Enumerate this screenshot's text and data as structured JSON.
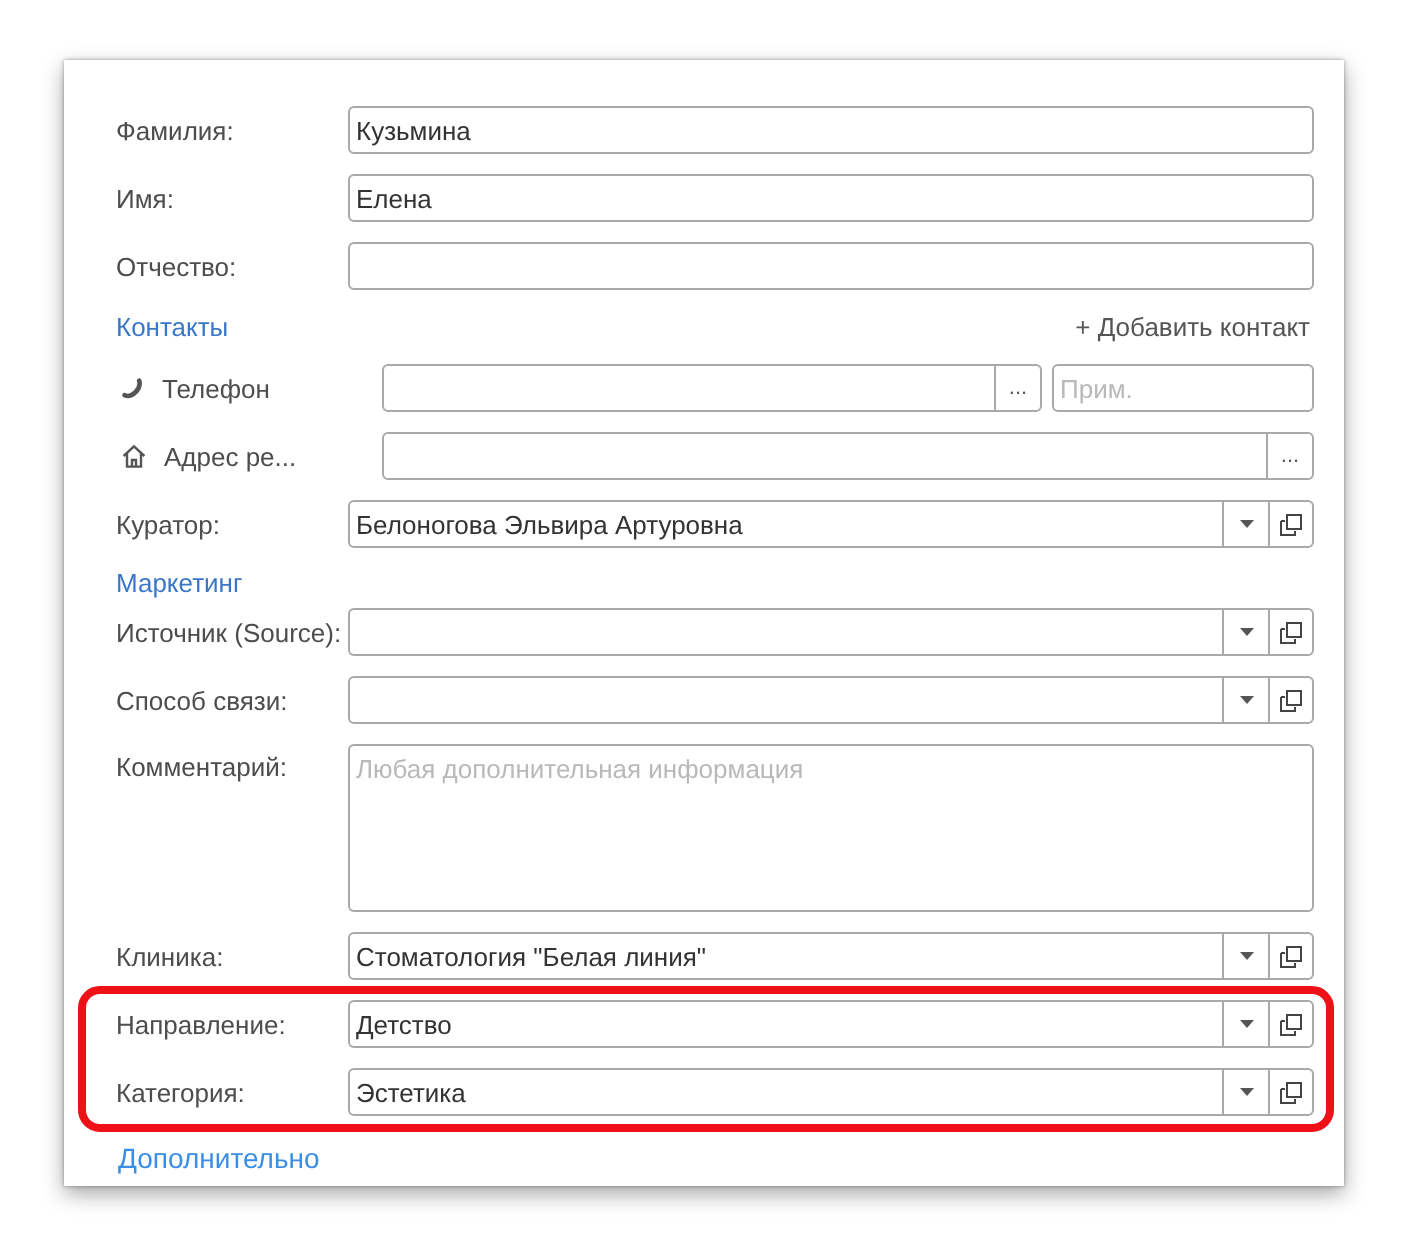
{
  "form": {
    "rows": [
      {
        "kind": "text",
        "label": "Фамилия:",
        "value": "Кузьмина",
        "highlighted": false
      },
      {
        "kind": "text",
        "label": "Имя:",
        "value": "Елена",
        "highlighted": false
      },
      {
        "kind": "text",
        "label": "Отчество:",
        "highlighted": false
      },
      {
        "kind": "section",
        "title": "Контакты",
        "action": "+ Добавить контакт",
        "highlighted": false
      },
      {
        "kind": "phone",
        "label": "Телефон",
        "button": "...",
        "note_placeholder": "Прим.",
        "highlighted": false
      },
      {
        "kind": "address",
        "label": "Адрес ре...",
        "button": "...",
        "highlighted": false
      },
      {
        "kind": "select",
        "label": "Куратор:",
        "value": "Белоногова Эльвира Артуровна",
        "highlighted": false
      },
      {
        "kind": "section",
        "title": "Маркетинг",
        "highlighted": false
      },
      {
        "kind": "select",
        "label": "Источник (Source):",
        "highlighted": false
      },
      {
        "kind": "select",
        "label": "Способ связи:",
        "highlighted": false
      },
      {
        "kind": "textarea",
        "label": "Комментарий:",
        "placeholder": "Любая дополнительная информация",
        "highlighted": false
      },
      {
        "kind": "select",
        "label": "Клиника:",
        "value": "Стоматология \"Белая линия\"",
        "highlighted": false
      },
      {
        "kind": "select",
        "label": "Направление:",
        "value": "Детство",
        "highlighted": true
      },
      {
        "kind": "select",
        "label": "Категория:",
        "value": "Эстетика",
        "highlighted": true
      },
      {
        "kind": "link",
        "title": "Дополнительно",
        "highlighted": false
      }
    ]
  }
}
